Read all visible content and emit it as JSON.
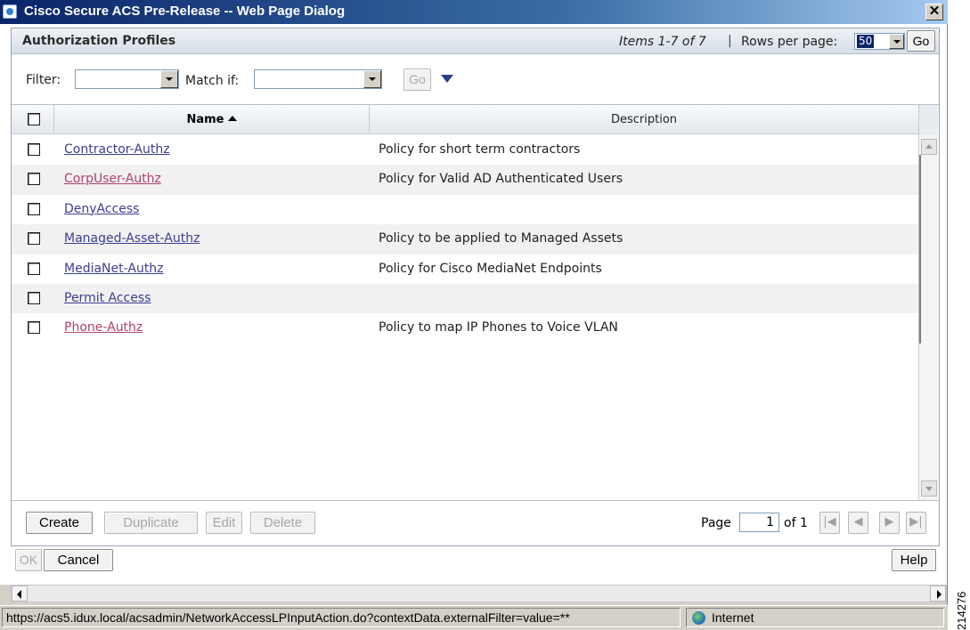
{
  "window": {
    "title": "Cisco Secure ACS Pre-Release -- Web Page Dialog",
    "close_glyph": "✕"
  },
  "panel": {
    "title": "Authorization Profiles",
    "items_info": "Items 1-7 of 7",
    "separator": "|",
    "rows_per_page_label": "Rows per page:",
    "rows_per_page_value": "50",
    "go_label": "Go"
  },
  "filter": {
    "filter_label": "Filter:",
    "filter_value": "",
    "match_label": "Match if:",
    "match_value": "",
    "go_label": "Go"
  },
  "grid": {
    "columns": [
      "Name",
      "Description"
    ],
    "rows": [
      {
        "name": "Contractor-Authz",
        "description": "Policy for short term contractors",
        "visited": false
      },
      {
        "name": "CorpUser-Authz",
        "description": "Policy for Valid AD Authenticated Users",
        "visited": true
      },
      {
        "name": "DenyAccess",
        "description": "",
        "visited": false
      },
      {
        "name": "Managed-Asset-Authz",
        "description": "Policy to be applied to Managed Assets",
        "visited": false
      },
      {
        "name": "MediaNet-Authz",
        "description": "Policy for Cisco MediaNet Endpoints",
        "visited": false
      },
      {
        "name": "Permit Access",
        "description": "",
        "visited": false
      },
      {
        "name": "Phone-Authz",
        "description": "Policy to map IP Phones to Voice VLAN",
        "visited": true
      }
    ]
  },
  "actions": {
    "create": "Create",
    "duplicate": "Duplicate",
    "edit": "Edit",
    "delete": "Delete"
  },
  "pagination": {
    "page_label": "Page",
    "page_value": "1",
    "of_label": "of 1"
  },
  "dialog": {
    "ok": "OK",
    "cancel": "Cancel",
    "help": "Help"
  },
  "status": {
    "url": "https://acs5.idux.local/acsadmin/NetworkAccessLPInputAction.do?contextData.externalFilter=value=**",
    "zone": "Internet"
  },
  "figure_id": "214276",
  "colors": {
    "link": "#3b3f8f",
    "visited_link": "#b0406e",
    "title_bar": "#0a246a"
  }
}
